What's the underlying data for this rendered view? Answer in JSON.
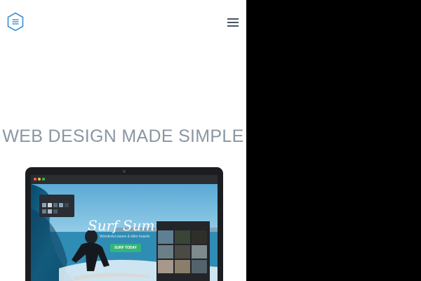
{
  "header": {
    "logo_icon": "hexagon-menu-icon",
    "menu_icon": "hamburger-menu-icon"
  },
  "hero": {
    "headline": "WEB DESIGN MADE SIMPLE"
  },
  "device_mockup": {
    "title": "Surf Summer",
    "subtitle": "Wonderful waves & killer boards",
    "cta_label": "SURF TODAY"
  },
  "colors": {
    "headline": "#8a96a3",
    "accent_button": "#33b57a",
    "logo_stroke": "#3b8fd6",
    "backdrop": "#000000"
  }
}
